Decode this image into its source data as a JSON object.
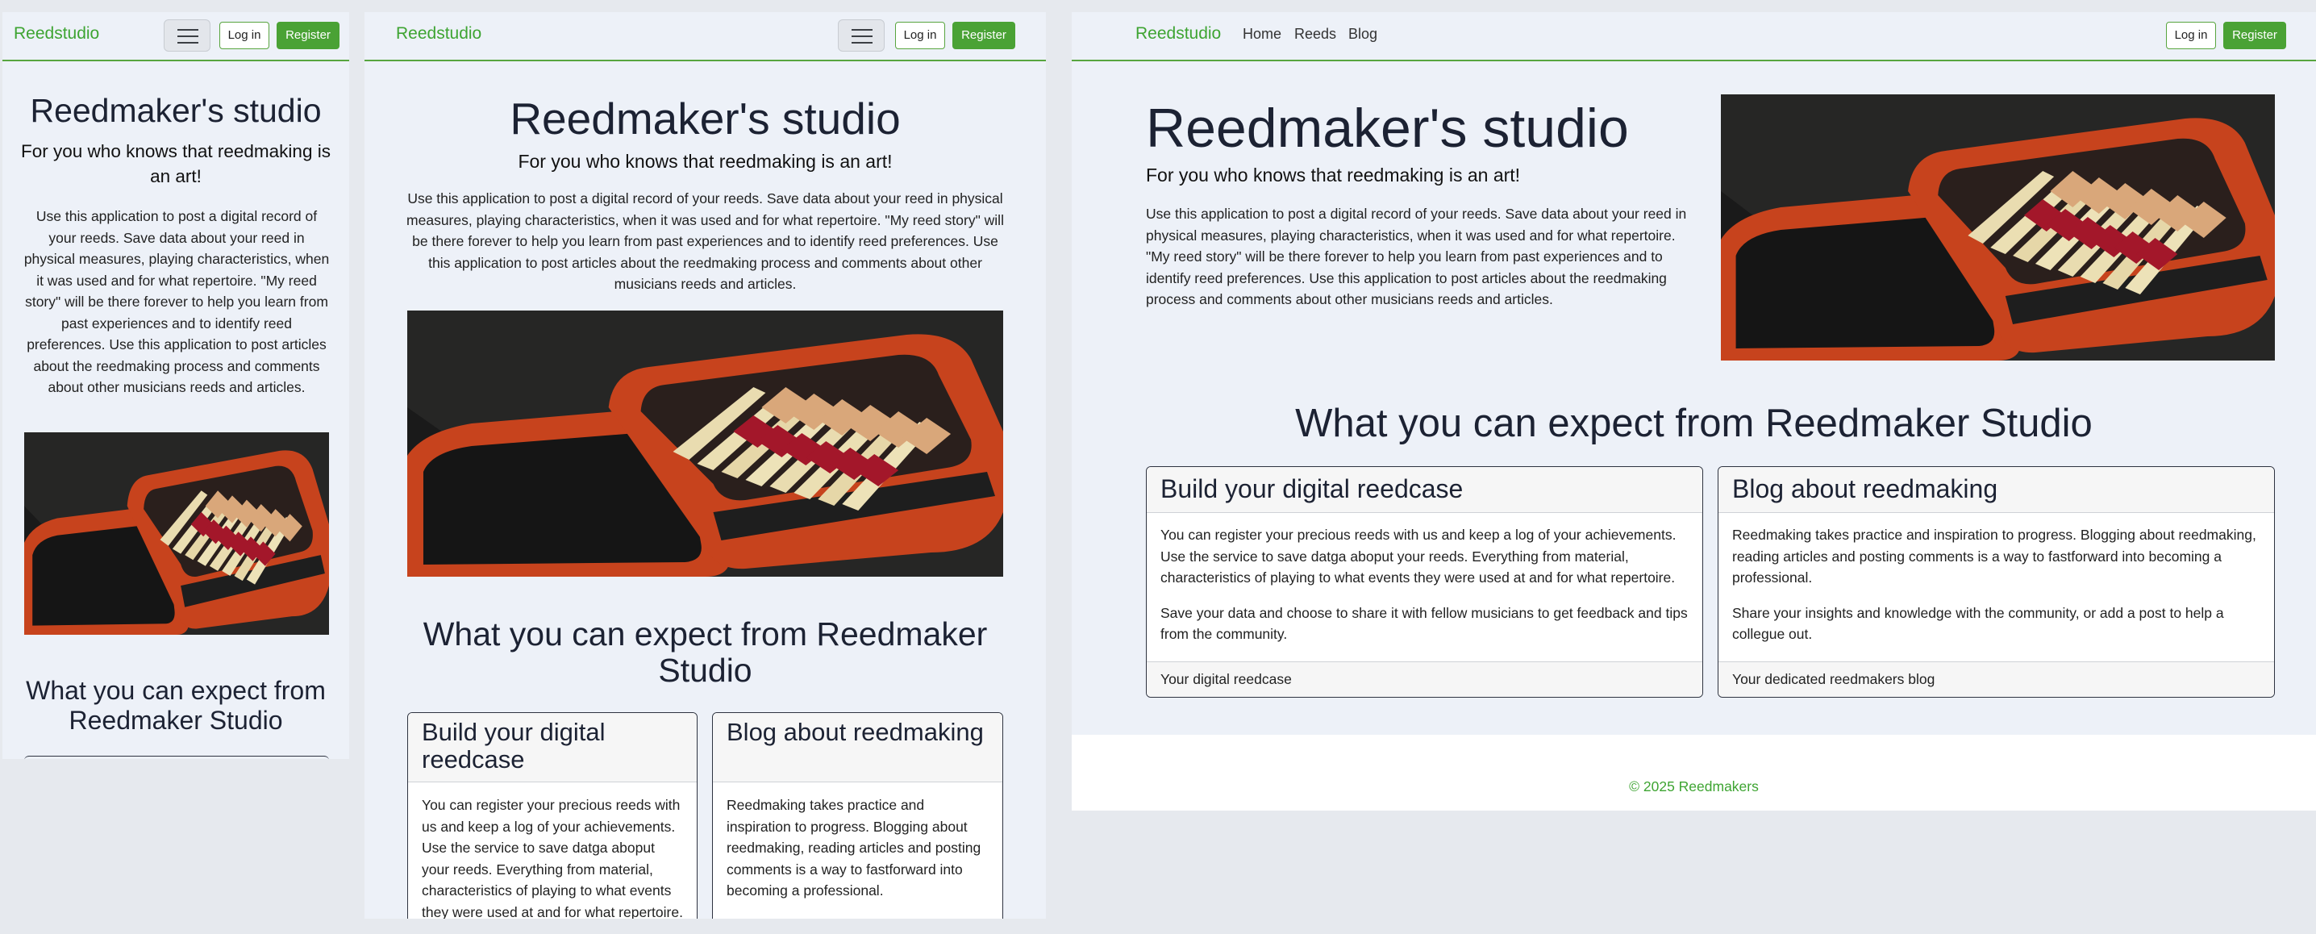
{
  "brand": "Reedstudio",
  "nav": {
    "login_label": "Log in",
    "register_label": "Register",
    "links": [
      "Home",
      "Reeds",
      "Blog"
    ]
  },
  "hero": {
    "title": "Reedmaker's studio",
    "subtitle": "For you who knows that reedmaking is an art!",
    "description": "Use this application to post a digital record of your reeds. Save data about your reed in physical measures, playing characteristics, when it was used and for what repertoire. \"My reed story\" will be there forever to help you learn from past experiences and to identify reed preferences. Use this application to post articles about the reedmaking process and comments about other musicians reeds and articles."
  },
  "features": {
    "heading": "What you can expect from Reedmaker Studio",
    "cards": [
      {
        "title": "Build your digital reedcase",
        "paragraphs": [
          "You can register your precious reeds with us and keep a log of your achievements. Use the service to save datga aboput your reeds. Everything from material, characteristics of playing to what events they were used at and for what repertoire.",
          "Save your data and choose to share it with fellow musicians to get feedback and tips from the community."
        ],
        "footer": "Your digital reedcase"
      },
      {
        "title": "Blog about reedmaking",
        "paragraphs": [
          "Reedmaking takes practice and inspiration to progress. Blogging about reedmaking, reading articles and posting comments is a way to fastforward into becoming a professional.",
          "Share your insights and knowledge with the community, or add a post to help a collegue out."
        ],
        "footer": "Your dedicated reedmakers blog"
      }
    ]
  },
  "footer": {
    "copyright": "© 2025 Reedmakers"
  },
  "colors": {
    "brand_green": "#3ea432",
    "page_bg": "#edf1f8",
    "reedcase_orange": "#c7431d"
  },
  "icons": [
    "hamburger-menu-icon"
  ]
}
